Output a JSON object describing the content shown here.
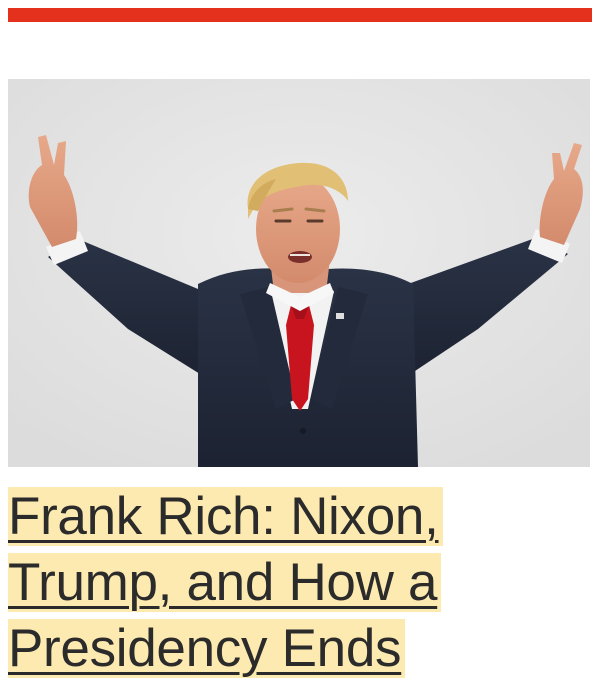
{
  "colors": {
    "accent": "#e3311d",
    "highlight": "#fdeab0",
    "text": "#2b2b2b"
  },
  "article": {
    "image_icon": "portrait-photo-icon",
    "headline": "Frank Rich: Nixon, Trump, and How a Presidency Ends"
  }
}
